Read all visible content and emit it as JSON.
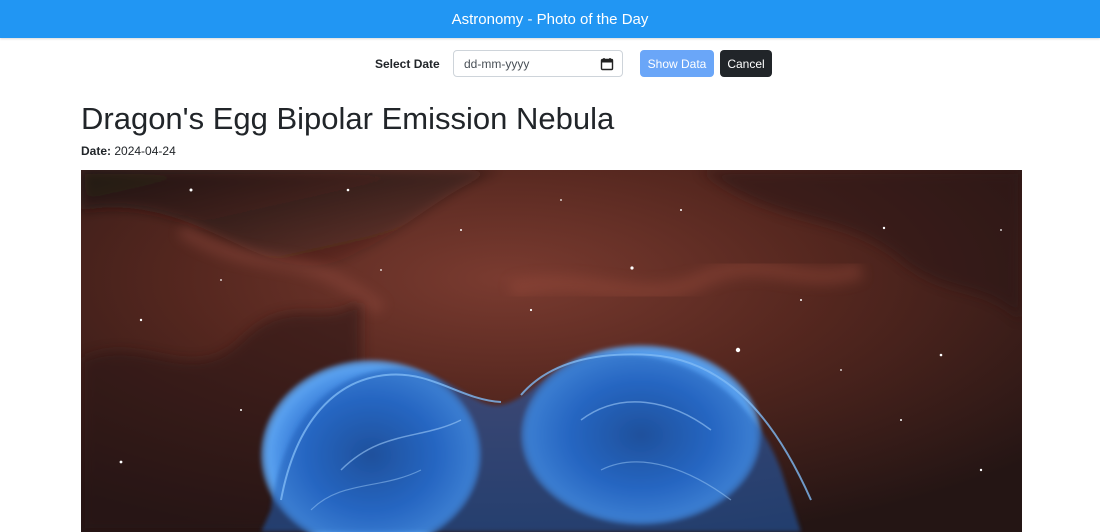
{
  "header": {
    "title": "Astronomy - Photo of the Day",
    "background_color": "#2196f3"
  },
  "controls": {
    "select_label": "Select Date",
    "date_input": {
      "placeholder": "dd-mm-yyyy",
      "value": "",
      "icon": "calendar-icon"
    },
    "show_button_label": "Show Data",
    "cancel_button_label": "Cancel",
    "show_button_color": "#6aa6f8",
    "cancel_button_color": "#212529"
  },
  "photo_of_day": {
    "title": "Dragon's Egg Bipolar Emission Nebula",
    "date_label": "Date:",
    "date_value": "2024-04-24"
  }
}
